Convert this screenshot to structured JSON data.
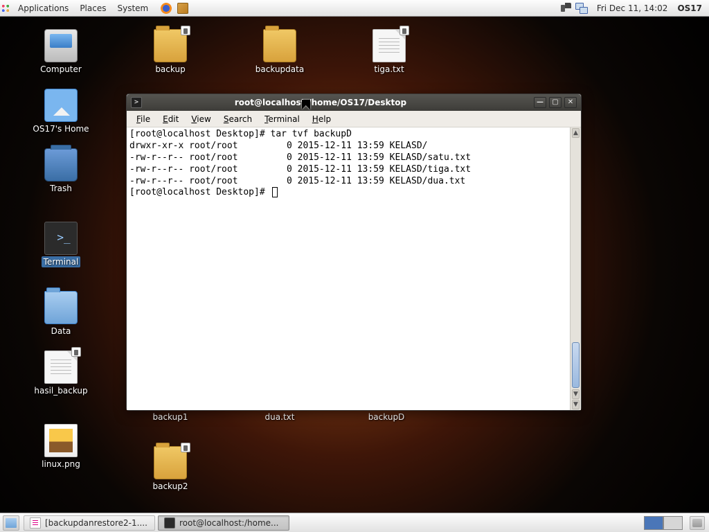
{
  "top_panel": {
    "menus": [
      "Applications",
      "Places",
      "System"
    ],
    "clock": "Fri Dec 11, 14:02",
    "hostname": "OS17"
  },
  "desktop_icons": {
    "computer": "Computer",
    "home": "OS17's Home",
    "trash": "Trash",
    "terminal": "Terminal",
    "data": "Data",
    "hasil_backup": "hasil_backup",
    "linux_png": "linux.png",
    "backup": "backup",
    "backup1": "backup1",
    "backup2": "backup2",
    "backupdata": "backupdata",
    "dua_txt": "dua.txt",
    "tiga_txt": "tiga.txt",
    "backupD": "backupD"
  },
  "terminal": {
    "title": "root@localhost:/home/OS17/Desktop",
    "menu": {
      "file": "File",
      "edit": "Edit",
      "view": "View",
      "search": "Search",
      "terminal": "Terminal",
      "help": "Help"
    },
    "lines": [
      "[root@localhost Desktop]# tar tvf backupD",
      "drwxr-xr-x root/root         0 2015-12-11 13:59 KELASD/",
      "-rw-r--r-- root/root         0 2015-12-11 13:59 KELASD/satu.txt",
      "-rw-r--r-- root/root         0 2015-12-11 13:59 KELASD/tiga.txt",
      "-rw-r--r-- root/root         0 2015-12-11 13:59 KELASD/dua.txt"
    ],
    "prompt": "[root@localhost Desktop]# "
  },
  "taskbar": {
    "task1": "[backupdanrestore2-1....",
    "task2": "root@localhost:/home..."
  }
}
